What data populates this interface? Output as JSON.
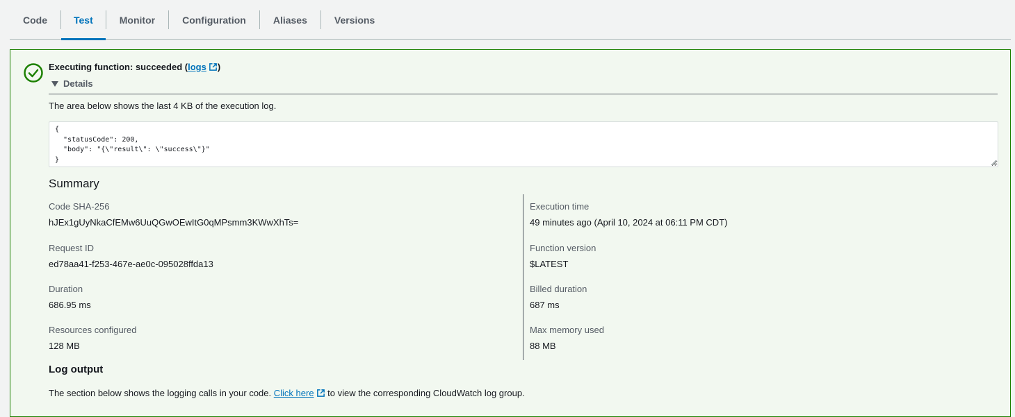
{
  "tabs": [
    {
      "label": "Code",
      "active": false
    },
    {
      "label": "Test",
      "active": true
    },
    {
      "label": "Monitor",
      "active": false
    },
    {
      "label": "Configuration",
      "active": false
    },
    {
      "label": "Aliases",
      "active": false
    },
    {
      "label": "Versions",
      "active": false
    }
  ],
  "colors": {
    "accent": "#0073bb",
    "success": "#1d8102",
    "success_bg": "#f2f8f0"
  },
  "result": {
    "prefix": "Executing function: succeeded (",
    "logs_link": "logs",
    "suffix": ")",
    "status_icon": "success-check-icon"
  },
  "details": {
    "label": "Details",
    "log_description": "The area below shows the last 4 KB of the execution log.",
    "log_text": "{\n  \"statusCode\": 200,\n  \"body\": \"{\\\"result\\\": \\\"success\\\"}\"\n}"
  },
  "summary": {
    "title": "Summary",
    "left": [
      {
        "label": "Code SHA-256",
        "value": "hJEx1gUyNkaCfEMw6UuQGwOEwItG0qMPsmm3KWwXhTs="
      },
      {
        "label": "Request ID",
        "value": "ed78aa41-f253-467e-ae0c-095028ffda13"
      },
      {
        "label": "Duration",
        "value": "686.95 ms"
      },
      {
        "label": "Resources configured",
        "value": "128 MB"
      }
    ],
    "right": [
      {
        "label": "Execution time",
        "value": "49 minutes ago (April 10, 2024 at 06:11 PM CDT)"
      },
      {
        "label": "Function version",
        "value": "$LATEST"
      },
      {
        "label": "Billed duration",
        "value": "687 ms"
      },
      {
        "label": "Max memory used",
        "value": "88 MB"
      }
    ]
  },
  "log_output": {
    "title": "Log output",
    "desc_prefix": "The section below shows the logging calls in your code. ",
    "link": "Click here",
    "desc_suffix": " to view the corresponding CloudWatch log group."
  }
}
